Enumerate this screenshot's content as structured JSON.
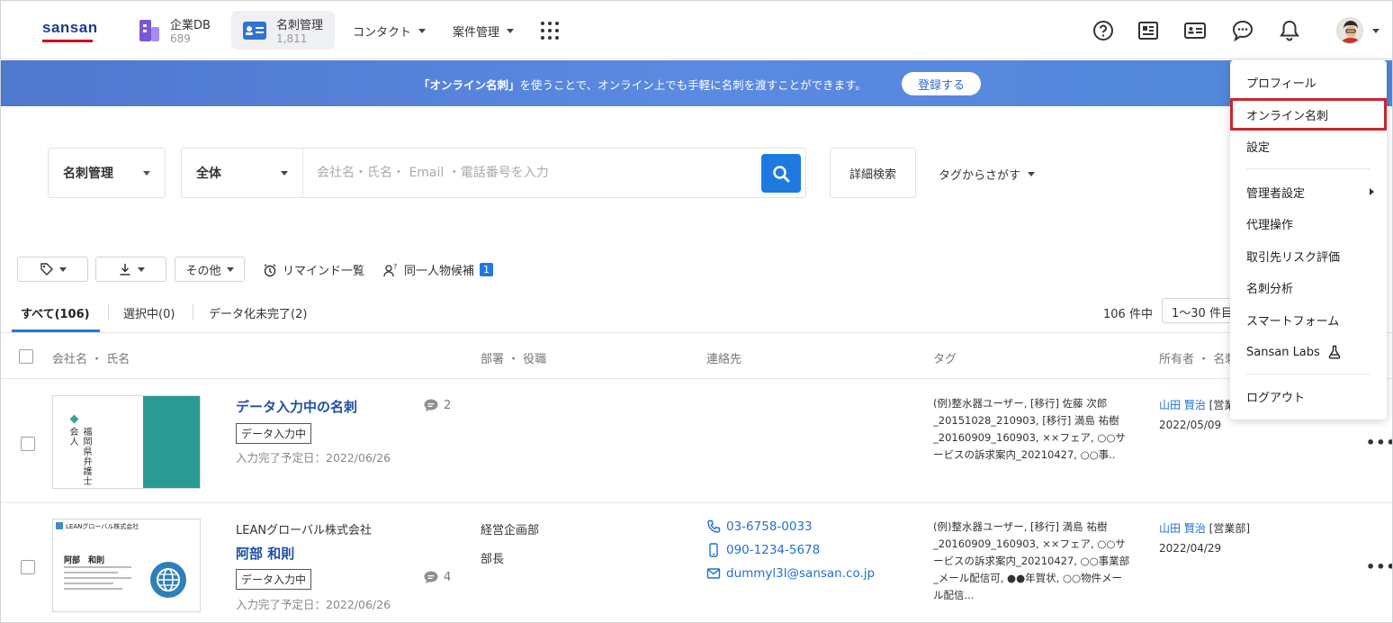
{
  "header": {
    "logo": "sansan",
    "apps": [
      {
        "title": "企業DB",
        "count": "689"
      },
      {
        "title": "名刺管理",
        "count": "1,811"
      }
    ],
    "menus": [
      "コンタクト",
      "案件管理"
    ],
    "icons": [
      "help-icon",
      "news-icon",
      "online-card-icon",
      "chat-icon",
      "bell-icon",
      "avatar"
    ]
  },
  "banner": {
    "highlight": "「オンライン名刺」",
    "text": "を使うことで、オンライン上でも手軽に名刺を渡すことができます。",
    "button": "登録する"
  },
  "search": {
    "category": "名刺管理",
    "scope": "全体",
    "placeholder": "会社名・氏名・ Email ・電話番号を入力",
    "advanced": "詳細検索",
    "tag_search": "タグからさがす"
  },
  "toolbar": {
    "other": "その他",
    "reminder": "リマインド一覧",
    "same_person": "同一人物候補",
    "same_person_count": "1"
  },
  "tabs": {
    "all": "すべて(106)",
    "selected": "選択中(0)",
    "incomplete": "データ化未完了(2)",
    "count": "106 件中",
    "page": "1〜30 件目"
  },
  "table": {
    "col_name": "会社名 ・ 氏名",
    "col_dept": "部署 ・ 役職",
    "col_contact": "連絡先",
    "col_tag": "タグ",
    "col_owner": "所有者 ・ 名刺"
  },
  "rows": [
    {
      "name": "データ入力中の名刺",
      "status": "データ入力中",
      "due": "入力完了予定日：2022/06/26",
      "comments": "2",
      "tags": "(例)整水器ユーザー, [移行] 佐藤 次郎_20151028_210903, [移行] 満島 祐樹_20160909_160903, ××フェア, ○○サービスの訴求案内_20210427, ○○事..",
      "owner_name": "山田 賢治",
      "owner_dept": "[営業部]",
      "date": "2022/05/09",
      "card_text": "福岡県弁護士会人"
    },
    {
      "company": "LEANグローバル株式会社",
      "name": "阿部 和則",
      "status": "データ入力中",
      "due": "入力完了予定日：2022/06/26",
      "comments": "4",
      "dept": "経営企画部",
      "title": "部長",
      "phone": "03-6758-0033",
      "mobile": "090-1234-5678",
      "email": "dummyl3l@sansan.co.jp",
      "tags": "(例)整水器ユーザー, [移行] 満島 祐樹_20160909_160903, ××フェア, ○○サービスの訴求案内_20210427, ○○事業部_メール配信可, ●●年賀状, ○○物件メール配信...",
      "owner_name": "山田 賢治",
      "owner_dept": "[営業部]",
      "date": "2022/04/29",
      "card_company": "LEANグローバル株式会社",
      "card_name": "阿部　和則"
    }
  ],
  "menu": {
    "items": [
      "プロフィール",
      "オンライン名刺",
      "設定",
      "管理者設定",
      "代理操作",
      "取引先リスク評価",
      "名刺分析",
      "スマートフォーム",
      "Sansan Labs",
      "ログアウト"
    ]
  }
}
